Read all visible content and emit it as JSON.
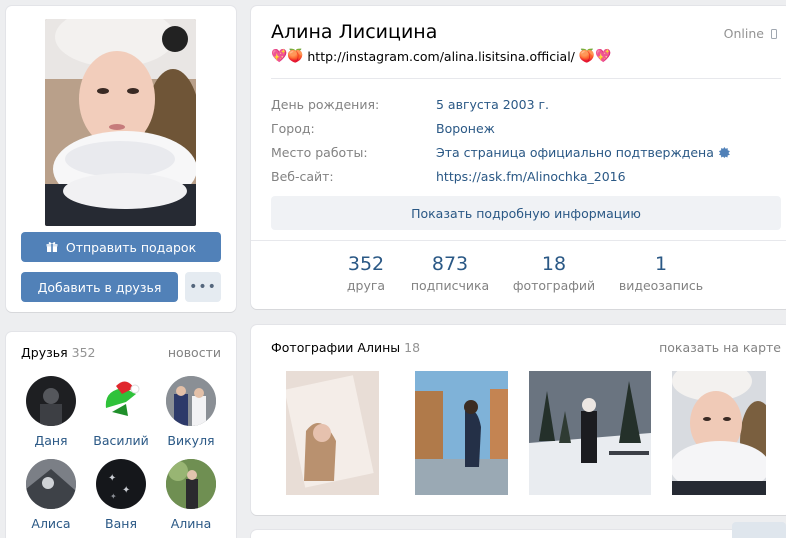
{
  "profile": {
    "name": "Алина Лисицина",
    "online": "Online",
    "status_emoji_left": "💖🍑",
    "status_url": "http://instagram.com/alina.lisitsina.official/",
    "status_emoji_right": "🍑💖",
    "info": [
      {
        "label": "День рождения:",
        "value": "5 августа 2003 г."
      },
      {
        "label": "Город:",
        "value": "Воронеж"
      },
      {
        "label": "Место работы:",
        "value": "Эта страница официально подтверждена"
      },
      {
        "label": "Веб-сайт:",
        "value": "https://ask.fm/Alinochka_2016"
      }
    ],
    "show_more": "Показать подробную информацию",
    "counters": [
      {
        "num": "352",
        "label": "друга"
      },
      {
        "num": "873",
        "label": "подписчика"
      },
      {
        "num": "18",
        "label": "фотографий"
      },
      {
        "num": "1",
        "label": "видеозапись"
      }
    ]
  },
  "actions": {
    "gift": "Отправить подарок",
    "add_friend": "Добавить в друзья",
    "more": "•••"
  },
  "friends": {
    "title": "Друзья",
    "count": "352",
    "link": "новости",
    "list": [
      {
        "name": "Даня"
      },
      {
        "name": "Василий"
      },
      {
        "name": "Викуля"
      },
      {
        "name": "Алиса"
      },
      {
        "name": "Ваня"
      },
      {
        "name": "Алина"
      }
    ]
  },
  "photos": {
    "title": "Фотографии Алины",
    "count": "18",
    "link": "показать на карте"
  },
  "colors": {
    "accent": "#5181b8",
    "link": "#2a5885",
    "muted": "#828282",
    "background": "#edeef0"
  }
}
